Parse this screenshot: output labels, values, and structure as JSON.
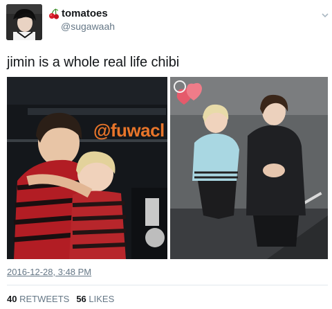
{
  "tweet": {
    "author": {
      "display_name": "tomatoes",
      "handle": "@sugawaah",
      "avatar_icon": "profile-photo",
      "name_emoji_icon": "cherry-icon"
    },
    "text": "jimin is a whole real life chibi",
    "photos": [
      {
        "overlay_text": "@fuwacl"
      },
      {
        "overlay_text": ""
      }
    ],
    "timestamp": "2016-12-28, 3:48 PM",
    "stats": {
      "retweets_count": "40",
      "retweets_label": "RETWEETS",
      "likes_count": "56",
      "likes_label": "LIKES"
    }
  },
  "colors": {
    "text_primary": "#14171a",
    "text_secondary": "#657786",
    "divider": "#e1e8ed",
    "overlay_text": "#e8752a"
  }
}
